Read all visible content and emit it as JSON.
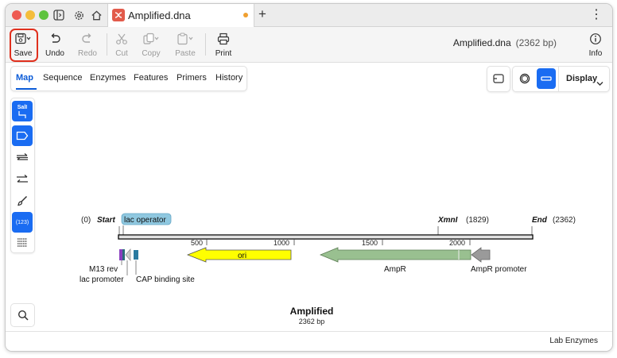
{
  "window": {
    "tab_title": "Amplified.dna",
    "new_tab": "+",
    "menu": "⋮"
  },
  "toolbar": {
    "save": "Save",
    "undo": "Undo",
    "redo": "Redo",
    "cut": "Cut",
    "copy": "Copy",
    "paste": "Paste",
    "print": "Print",
    "info": "Info",
    "doc_name": "Amplified.dna",
    "doc_length": "(2362 bp)"
  },
  "view_tabs": [
    "Map",
    "Sequence",
    "Enzymes",
    "Features",
    "Primers",
    "History"
  ],
  "view_controls": {
    "display": "Display"
  },
  "side_tools": {
    "sali_label": "SalI",
    "count_label": "(123)"
  },
  "map": {
    "origin_label": "(0)",
    "start_label": "Start",
    "end_label": "End",
    "end_value": "(2362)",
    "site": {
      "name": "XmnI",
      "pos": "(1829)"
    },
    "ticks": [
      "500",
      "1000",
      "1500",
      "2000"
    ],
    "features": {
      "lac_operator": "lac operator",
      "ori": "ori",
      "ampr": "AmpR",
      "ampr_promoter": "AmpR promoter",
      "m13_rev": "M13 rev",
      "lac_promoter": "lac promoter",
      "cap_site": "CAP binding site"
    },
    "title": "Amplified",
    "subtitle": "2362 bp"
  },
  "colors": {
    "ori": "#ffff00",
    "ampr": "#99c090",
    "ampr_promoter": "#9a9a9a",
    "lac_operator": "#8fc8e0",
    "accent": "#1a6cf2",
    "save_highlight": "#e0301e"
  },
  "status": {
    "right": "Lab Enzymes"
  }
}
